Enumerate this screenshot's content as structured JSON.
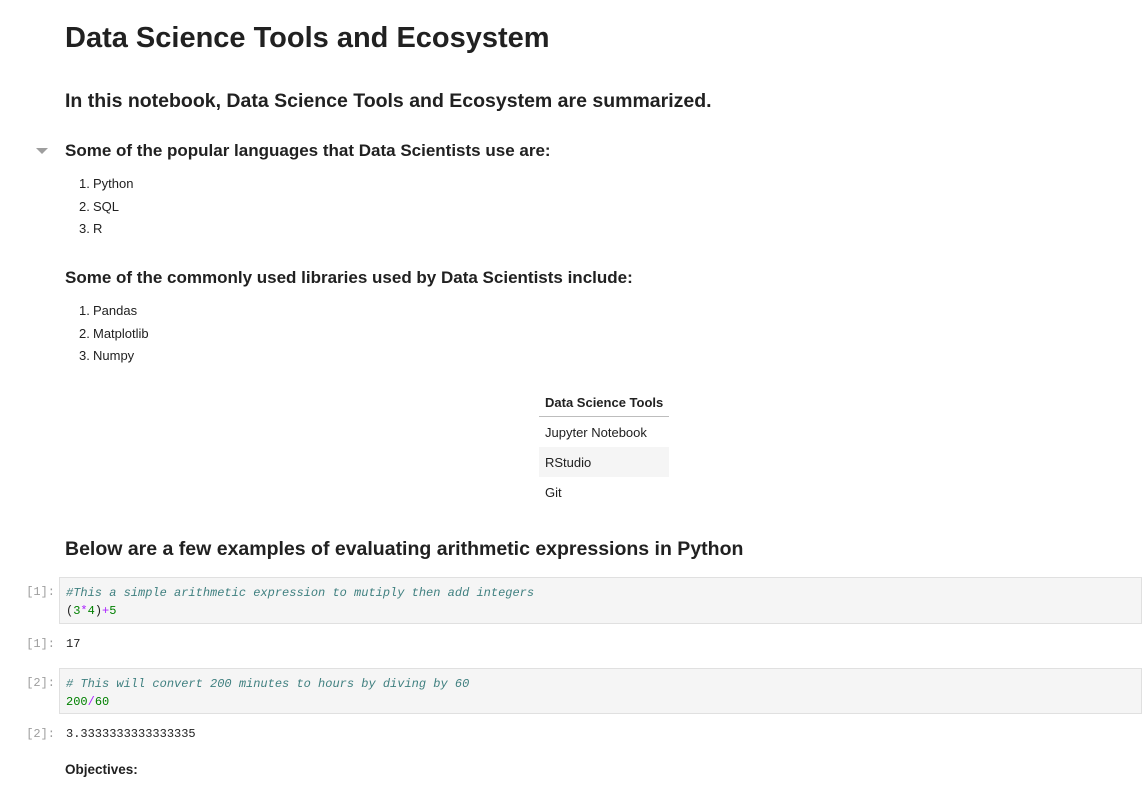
{
  "notebook": {
    "title": "Data Science Tools and Ecosystem",
    "subtitle": "In this notebook, Data Science Tools and Ecosystem are summarized.",
    "languages_heading": "Some of the popular languages that Data Scientists use are:",
    "languages": [
      "Python",
      "SQL",
      "R"
    ],
    "libraries_heading": "Some of the commonly used libraries used by Data Scientists include:",
    "libraries": [
      "Pandas",
      "Matplotlib",
      "Numpy"
    ],
    "tools_table": {
      "header": "Data Science Tools",
      "rows": [
        "Jupyter Notebook",
        "RStudio",
        "Git"
      ]
    },
    "examples_heading": "Below are a few examples of evaluating arithmetic expressions in Python",
    "cells": [
      {
        "in_prompt": "[1]:",
        "comment": "#This a simple arithmetic expression to mutiply then add integers",
        "code_tokens": [
          "(",
          "3",
          "*",
          "4",
          ")",
          "+",
          "5"
        ],
        "out_prompt": "[1]:",
        "output": "17"
      },
      {
        "in_prompt": "[2]:",
        "comment": "# This will convert 200 minutes to hours by diving by 60",
        "code_tokens": [
          "200",
          "/",
          "60"
        ],
        "out_prompt": "[2]:",
        "output": "3.3333333333333335"
      }
    ],
    "objectives_heading": "Objectives:"
  }
}
